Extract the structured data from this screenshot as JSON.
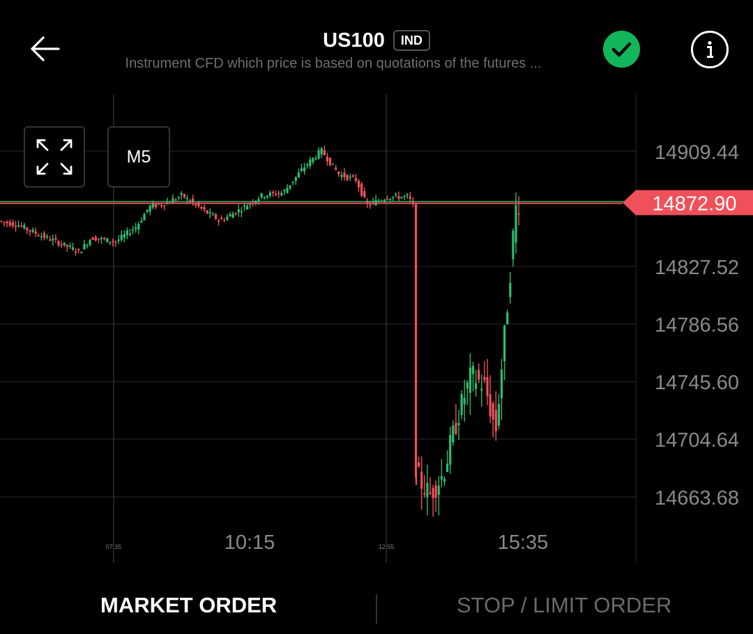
{
  "header": {
    "title": "US100",
    "badge": "IND",
    "subtitle": "Instrument CFD which price is based on quotations of the futures ...",
    "back_icon": "arrow-left-icon",
    "status_icon": "check-circle-icon",
    "info_icon": "info-icon",
    "status_color": "#12b65a"
  },
  "controls": {
    "expand_icon": "expand-icon",
    "timeframe": "M5"
  },
  "chart_data": {
    "type": "candlestick",
    "y_ticks": [
      "14909.44",
      "14827.52",
      "14786.56",
      "14745.60",
      "14704.64",
      "14663.68"
    ],
    "ylim": [
      14645,
      14950
    ],
    "current_price": "14872.90",
    "current_price_value": 14872.9,
    "x_labels_major": [
      "10:15",
      "15:35"
    ],
    "x_labels_minor": [
      "07:35",
      "12:55"
    ],
    "colors": {
      "up": "#2dbd6e",
      "down": "#f0505a",
      "grid": "#2a2a2a",
      "price_line": "#f0505a"
    }
  },
  "footer": {
    "market_order": "MARKET ORDER",
    "stop_limit_order": "STOP / LIMIT ORDER"
  }
}
